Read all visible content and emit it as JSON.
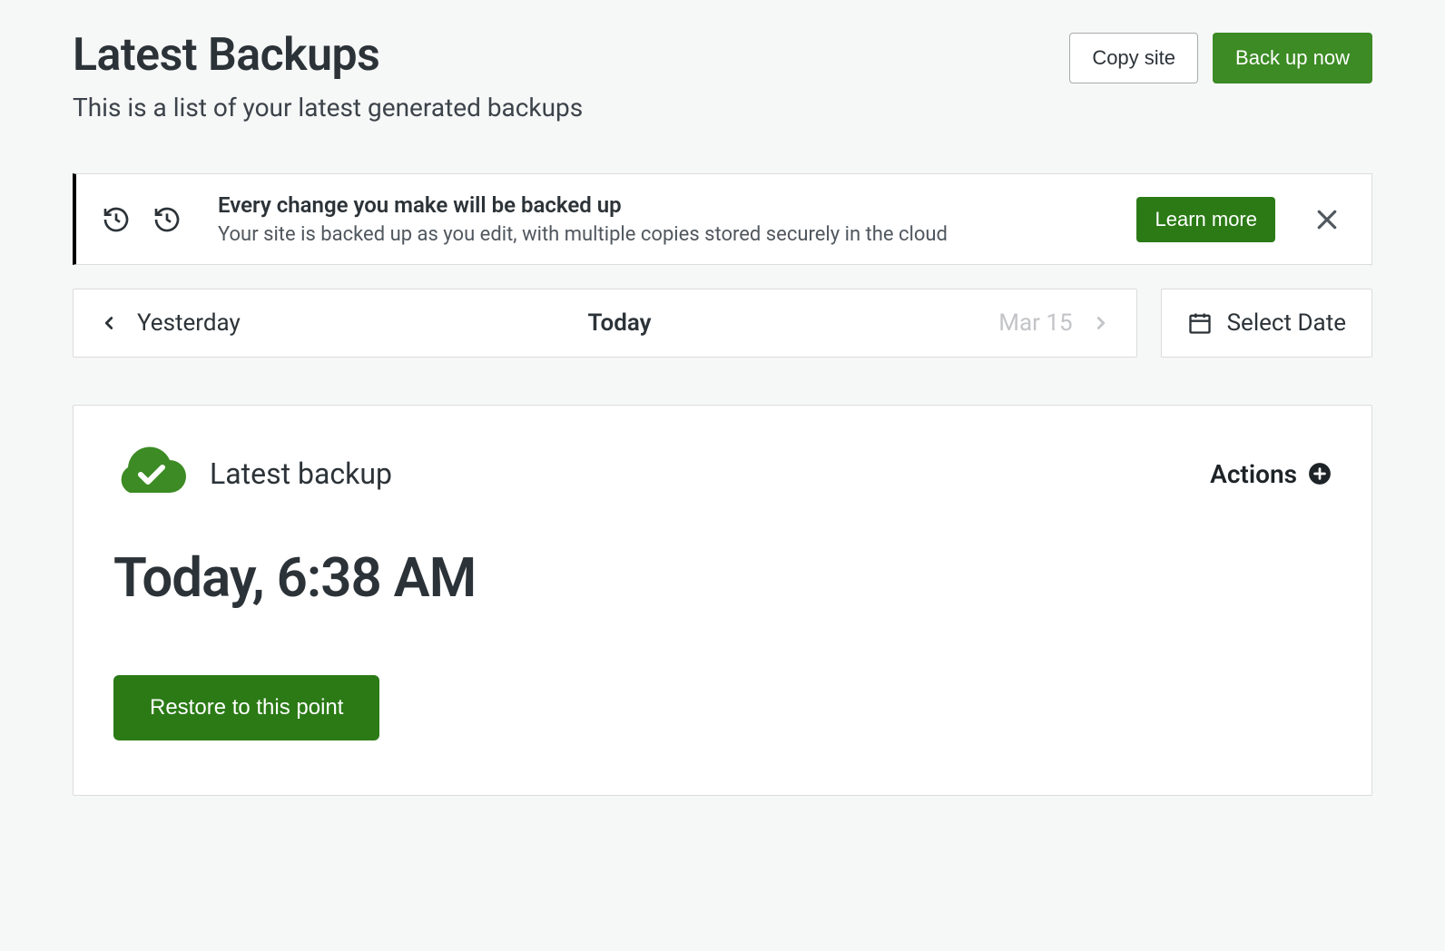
{
  "header": {
    "title": "Latest Backups",
    "subtitle": "This is a list of your latest generated backups",
    "copy_site_label": "Copy site",
    "backup_now_label": "Back up now"
  },
  "banner": {
    "title": "Every change you make will be backed up",
    "description": "Your site is backed up as you edit, with multiple copies stored securely in the cloud",
    "learn_more_label": "Learn more"
  },
  "date_nav": {
    "prev_label": "Yesterday",
    "current_label": "Today",
    "next_label": "Mar 15",
    "select_date_label": "Select Date"
  },
  "backup_card": {
    "label": "Latest backup",
    "actions_label": "Actions",
    "timestamp": "Today, 6:38 AM",
    "restore_label": "Restore to this point"
  }
}
